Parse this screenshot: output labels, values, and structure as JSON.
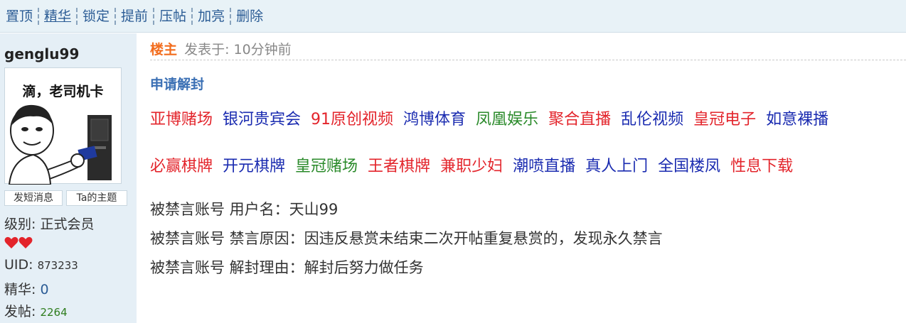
{
  "toolbar": {
    "items": [
      "置顶",
      "精华",
      "锁定",
      "提前",
      "压帖",
      "加亮",
      "删除"
    ]
  },
  "user": {
    "name": "genglu99",
    "avatar_caption": "滴，老司机卡",
    "pm_button": "发短消息",
    "topics_button": "Ta的主题",
    "level_label": "级别:",
    "level_value": "正式会员",
    "uid_label": "UID:",
    "uid_value": "873233",
    "digest_label": "精华:",
    "digest_value": "0",
    "posts_label": "发帖:",
    "posts_value": "2264",
    "hearts_icon": "heart-icon",
    "heart_color": "#e3242b"
  },
  "post": {
    "owner_label": "楼主",
    "posted_text": "发表于: 10分钟前",
    "title": "申请解封",
    "links_row1": [
      {
        "text": "亚博赌场",
        "color": "red"
      },
      {
        "text": "银河贵宾会",
        "color": "blue"
      },
      {
        "text": "91原创视频",
        "color": "red"
      },
      {
        "text": "鸿博体育",
        "color": "blue"
      },
      {
        "text": "凤凰娱乐",
        "color": "green"
      },
      {
        "text": "聚合直播",
        "color": "red"
      },
      {
        "text": "乱伦视频",
        "color": "blue"
      },
      {
        "text": "皇冠电子",
        "color": "red"
      },
      {
        "text": "如意裸播",
        "color": "blue"
      }
    ],
    "links_row2": [
      {
        "text": "必赢棋牌",
        "color": "red"
      },
      {
        "text": "开元棋牌",
        "color": "blue"
      },
      {
        "text": "皇冠赌场",
        "color": "green"
      },
      {
        "text": "王者棋牌",
        "color": "red"
      },
      {
        "text": "兼职少妇",
        "color": "red"
      },
      {
        "text": "潮喷直播",
        "color": "blue"
      },
      {
        "text": "真人上门",
        "color": "blue"
      },
      {
        "text": "全国楼凤",
        "color": "blue"
      },
      {
        "text": "性息下载",
        "color": "red"
      }
    ],
    "line_username": "被禁言账号 用户名：天山99",
    "line_reason": "被禁言账号 禁言原因：因违反悬赏未结束二次开帖重复悬赏的，发现永久禁言",
    "line_unban": "被禁言账号 解封理由：解封后努力做任务"
  }
}
